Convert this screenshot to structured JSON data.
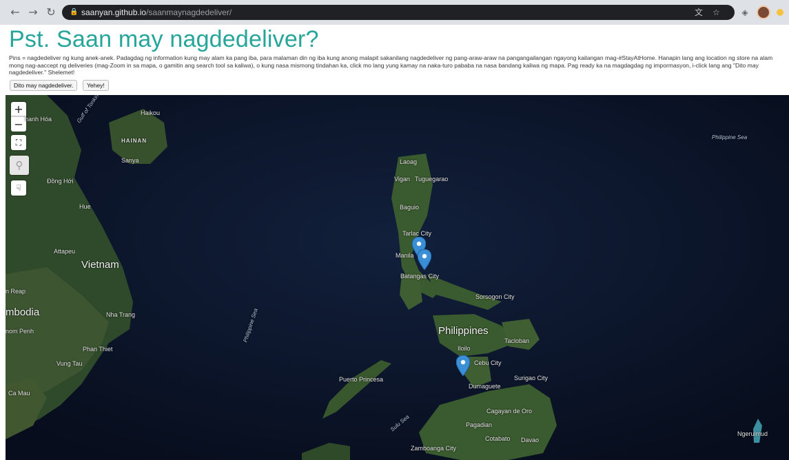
{
  "browser": {
    "url_host": "saanyan.github.io",
    "url_path": "/saanmaynagdedeliver/",
    "back_icon": "arrow-left-icon",
    "forward_icon": "arrow-right-icon",
    "reload_icon": "reload-icon",
    "lock_icon": "lock-icon",
    "translate_icon": "translate-icon",
    "bookmark_icon": "star-icon"
  },
  "page": {
    "title": "Pst. Saan may nagdedeliver?",
    "description": "Pins = nagdedeliver ng kung anek-anek. Padagdag ng information kung may alam ka pang iba, para malaman din ng iba kung anong malapit sakanilang nagdedeliver ng pang-araw-araw na pangangailangan ngayong kailangan mag-#StayAtHome. Hanapin lang ang location ng store na alam mong nag-aaccept ng deliveries (mag-Zoom in sa mapa, o gamitin ang search tool sa kaliwa), o kung nasa mismong tindahan ka, click mo lang yung kamay na naka-turo pababa na nasa bandang kaliwa ng mapa. Pag ready ka na magdagdag ng impormasyon, i-click lang ang \"Dito may nagdedeliver.\" Shelemet!",
    "buttons": {
      "add": "Dito may nagdedeliver.",
      "yehey": "Yehey!"
    }
  },
  "map": {
    "controls": {
      "zoom_in": "+",
      "zoom_out": "−"
    },
    "labels": {
      "gulf_tonkin": "Gulf of Tonkin",
      "haikou": "Haikou",
      "hainan": "HAINAN",
      "sanya": "Sanya",
      "thanh_hoa": "hanh Hóa",
      "dong_hoi": "Đồng Hới",
      "hue": "Hue",
      "attapeu": "Attapeu",
      "vietnam": "Vietnam",
      "siem_reap": "n Reap",
      "cambodia": "mbodia",
      "nha_trang": "Nha Trang",
      "phnom_penh": "nom Penh",
      "phan_thiet": "Phan Thiet",
      "vung_tau": "Vung Tau",
      "ca_mau": "Ca Mau",
      "laoag": "Laoag",
      "vigan": "Vigan",
      "tuguegarao": "Tuguegarao",
      "baguio": "Baguio",
      "tarlac": "Tarlac City",
      "manila": "Manila",
      "batangas": "Batangas City",
      "sorsogon": "Sorsogon City",
      "philippines": "Philippines",
      "tacloban": "Tacloban",
      "iloilo": "Iloilo",
      "cebu": "Cebu City",
      "surigao": "Surigao City",
      "dumaguete": "Dumaguete",
      "puerto_princesa": "Puerto Princesa",
      "sulu_sea": "Sulu Sea",
      "cagayan": "Cagayan de Oro",
      "pagadian": "Pagadian",
      "cotabato": "Cotabato",
      "davao": "Davao",
      "zamboanga": "Zamboanga City",
      "philippine_sea": "Philippine Sea",
      "ngerulmud": "Ngerulmud",
      "west_ph_sea": "Philippine Sea"
    },
    "pin_color": "#3a8fd6"
  }
}
